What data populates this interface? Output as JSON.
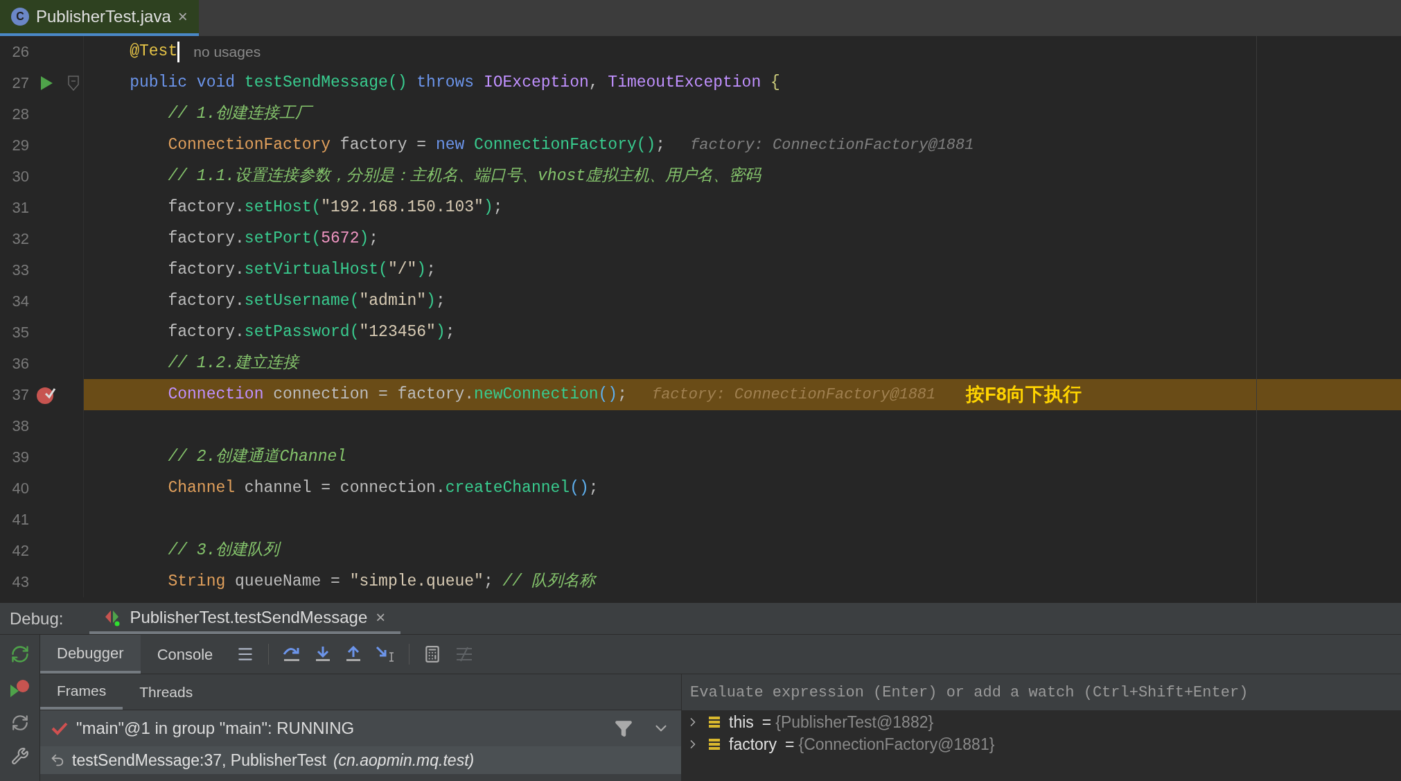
{
  "editor_tab": {
    "title": "PublisherTest.java",
    "icon_letter": "C",
    "close": "×",
    "selected": true
  },
  "code_lines": [
    {
      "number": "26",
      "tokens": [
        {
          "kind": "annotation",
          "text": "    @Test"
        }
      ],
      "usage_hint": "no usages",
      "caret": true
    },
    {
      "number": "27",
      "run": true,
      "fold": true,
      "tokens": [
        {
          "kind": "keyword",
          "text": "    public void "
        },
        {
          "kind": "method",
          "text": "testSendMessage() "
        },
        {
          "kind": "keyword",
          "text": "throws "
        },
        {
          "kind": "interface",
          "text": "IOException"
        },
        {
          "kind": "plain",
          "text": ", "
        },
        {
          "kind": "interface",
          "text": "TimeoutException"
        },
        {
          "kind": "brace",
          "text": " {"
        }
      ]
    },
    {
      "number": "28",
      "tokens": [
        {
          "kind": "comment",
          "text": "        // 1.创建连接工厂"
        }
      ]
    },
    {
      "number": "29",
      "tokens": [
        {
          "kind": "class",
          "text": "        ConnectionFactory"
        },
        {
          "kind": "plain",
          "text": " factory = "
        },
        {
          "kind": "keyword",
          "text": "new "
        },
        {
          "kind": "method",
          "text": "ConnectionFactory()"
        },
        {
          "kind": "plain",
          "text": ";"
        }
      ],
      "value_hint": "factory: ConnectionFactory@1881"
    },
    {
      "number": "30",
      "tokens": [
        {
          "kind": "comment",
          "text": "        // 1.1.设置连接参数，分别是：主机名、端口号、vhost虚拟主机、用户名、密码"
        }
      ]
    },
    {
      "number": "31",
      "tokens": [
        {
          "kind": "plain",
          "text": "        factory."
        },
        {
          "kind": "method",
          "text": "setHost("
        },
        {
          "kind": "string",
          "text": "\"192.168.150.103\""
        },
        {
          "kind": "method",
          "text": ")"
        },
        {
          "kind": "plain",
          "text": ";"
        }
      ]
    },
    {
      "number": "32",
      "tokens": [
        {
          "kind": "plain",
          "text": "        factory."
        },
        {
          "kind": "method",
          "text": "setPort("
        },
        {
          "kind": "number",
          "text": "5672"
        },
        {
          "kind": "method",
          "text": ")"
        },
        {
          "kind": "plain",
          "text": ";"
        }
      ]
    },
    {
      "number": "33",
      "tokens": [
        {
          "kind": "plain",
          "text": "        factory."
        },
        {
          "kind": "method",
          "text": "setVirtualHost("
        },
        {
          "kind": "string",
          "text": "\"/\""
        },
        {
          "kind": "method",
          "text": ")"
        },
        {
          "kind": "plain",
          "text": ";"
        }
      ]
    },
    {
      "number": "34",
      "tokens": [
        {
          "kind": "plain",
          "text": "        factory."
        },
        {
          "kind": "method",
          "text": "setUsername("
        },
        {
          "kind": "string",
          "text": "\"admin\""
        },
        {
          "kind": "method",
          "text": ")"
        },
        {
          "kind": "plain",
          "text": ";"
        }
      ]
    },
    {
      "number": "35",
      "tokens": [
        {
          "kind": "plain",
          "text": "        factory."
        },
        {
          "kind": "method",
          "text": "setPassword("
        },
        {
          "kind": "string",
          "text": "\"123456\""
        },
        {
          "kind": "method",
          "text": ")"
        },
        {
          "kind": "plain",
          "text": ";"
        }
      ]
    },
    {
      "number": "36",
      "tokens": [
        {
          "kind": "comment",
          "text": "        // 1.2.建立连接"
        }
      ]
    },
    {
      "number": "37",
      "breakpoint": true,
      "current": true,
      "tokens": [
        {
          "kind": "interface",
          "text": "        Connection"
        },
        {
          "kind": "plain",
          "text": " connection = factory."
        },
        {
          "kind": "method",
          "text": "newConnection"
        },
        {
          "kind": "paren",
          "text": "()"
        },
        {
          "kind": "plain",
          "text": ";"
        }
      ],
      "value_hint": "factory: ConnectionFactory@1881",
      "note": "按F8向下执行"
    },
    {
      "number": "38"
    },
    {
      "number": "39",
      "tokens": [
        {
          "kind": "comment",
          "text": "        // 2.创建通道Channel"
        }
      ]
    },
    {
      "number": "40",
      "tokens": [
        {
          "kind": "class",
          "text": "        Channel"
        },
        {
          "kind": "plain",
          "text": " channel = connection."
        },
        {
          "kind": "method",
          "text": "createChannel"
        },
        {
          "kind": "paren",
          "text": "()"
        },
        {
          "kind": "plain",
          "text": ";"
        }
      ]
    },
    {
      "number": "41"
    },
    {
      "number": "42",
      "tokens": [
        {
          "kind": "comment",
          "text": "        // 3.创建队列"
        }
      ]
    },
    {
      "number": "43",
      "tokens": [
        {
          "kind": "class",
          "text": "        String"
        },
        {
          "kind": "plain",
          "text": " queueName = "
        },
        {
          "kind": "string",
          "text": "\"simple.queue\""
        },
        {
          "kind": "plain",
          "text": "; "
        },
        {
          "kind": "comment",
          "text": "// 队列名称"
        }
      ]
    }
  ],
  "debug": {
    "label": "Debug:",
    "session": {
      "title": "PublisherTest.testSendMessage",
      "close": "×"
    },
    "tabs": [
      {
        "label": "Debugger",
        "selected": true
      },
      {
        "label": "Console",
        "selected": false
      }
    ],
    "subtabs": [
      {
        "label": "Frames",
        "selected": true
      },
      {
        "label": "Threads",
        "selected": false
      }
    ],
    "thread": "\"main\"@1 in group \"main\": RUNNING",
    "frames": [
      {
        "method": "testSendMessage:37, PublisherTest",
        "package": "(cn.aopmin.mq.test)",
        "selected": true
      }
    ],
    "evaluate_placeholder": "Evaluate expression (Enter) or add a watch (Ctrl+Shift+Enter)",
    "variables": [
      {
        "name": "this",
        "sign": "=",
        "value": "{PublisherTest@1882}"
      },
      {
        "name": "factory",
        "sign": "=",
        "value": "{ConnectionFactory@1881}"
      }
    ]
  }
}
